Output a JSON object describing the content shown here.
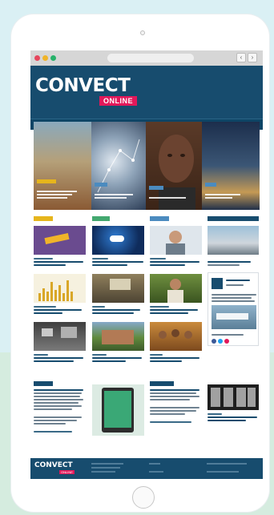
{
  "brand": {
    "logo_text": "CONVECT",
    "badge_text": "ONLINE",
    "primary_color": "#174c6e",
    "accent_color": "#e2185a"
  },
  "browser": {
    "back_label": "‹",
    "forward_label": "›"
  },
  "footer": {
    "logo_text": "CONVECT",
    "badge_text": "ONLINE"
  },
  "colors": {
    "tag_yellow": "#e6b51c",
    "tag_green": "#43a86f",
    "tag_blue": "#4b8bbf",
    "tag_navy": "#174c6e"
  }
}
